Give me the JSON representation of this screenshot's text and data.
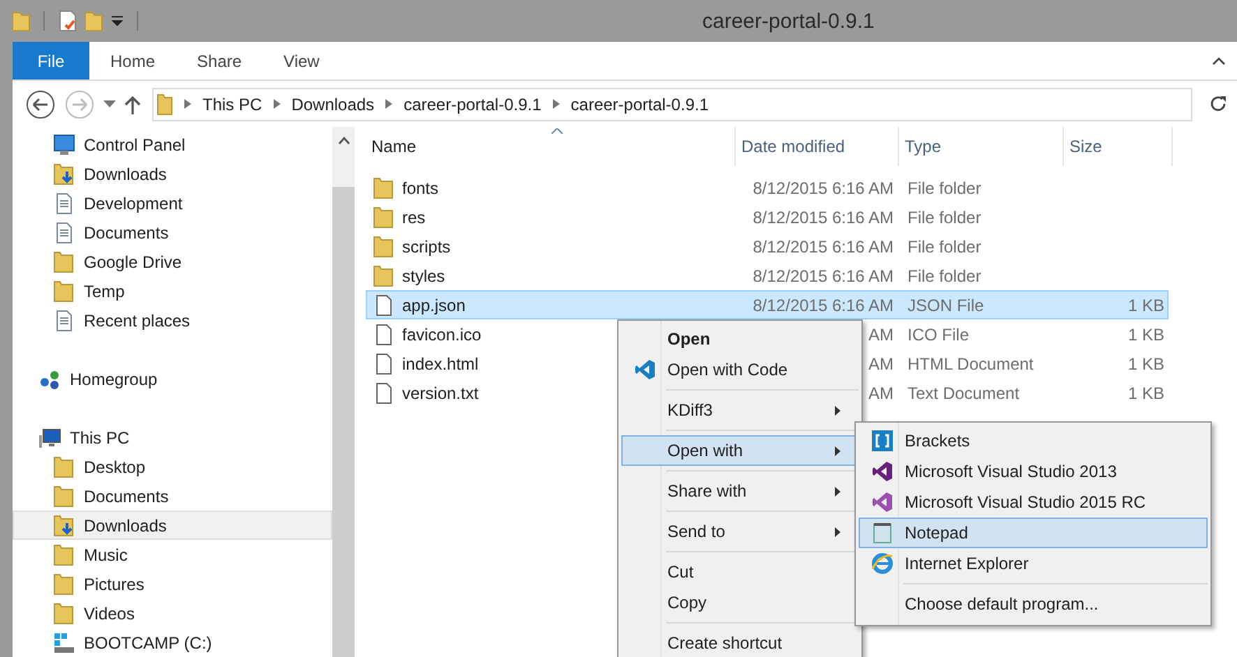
{
  "window": {
    "title": "career-portal-0.9.1"
  },
  "ribbon_tabs": [
    {
      "label": "File",
      "selected": true
    },
    {
      "label": "Home",
      "selected": false
    },
    {
      "label": "Share",
      "selected": false
    },
    {
      "label": "View",
      "selected": false
    }
  ],
  "breadcrumbs": [
    "This PC",
    "Downloads",
    "career-portal-0.9.1",
    "career-portal-0.9.1"
  ],
  "navigation": [
    {
      "children": [
        {
          "label": "Control Panel",
          "selected": false
        },
        {
          "label": "Downloads",
          "selected": false
        },
        {
          "label": "Development",
          "selected": false
        },
        {
          "label": "Documents",
          "selected": false
        },
        {
          "label": "Google Drive",
          "selected": false
        },
        {
          "label": "Temp",
          "selected": false
        },
        {
          "label": "Recent places",
          "selected": false
        }
      ]
    },
    {
      "label": "Homegroup",
      "selected": false
    },
    {
      "label": "This PC",
      "selected": false,
      "children": [
        {
          "label": "Desktop",
          "selected": false
        },
        {
          "label": "Documents",
          "selected": false
        },
        {
          "label": "Downloads",
          "selected": true
        },
        {
          "label": "Music",
          "selected": false
        },
        {
          "label": "Pictures",
          "selected": false
        },
        {
          "label": "Videos",
          "selected": false
        },
        {
          "label": "BOOTCAMP (C:)",
          "selected": false
        }
      ]
    }
  ],
  "table": {
    "columns": [
      "Name",
      "Date modified",
      "Type",
      "Size"
    ],
    "rows": [
      {
        "kind": "folder",
        "name": "fonts",
        "date": "8/12/2015 6:16 AM",
        "type": "File folder",
        "selected": false
      },
      {
        "kind": "folder",
        "name": "res",
        "date": "8/12/2015 6:16 AM",
        "type": "File folder",
        "selected": false
      },
      {
        "kind": "folder",
        "name": "scripts",
        "date": "8/12/2015 6:16 AM",
        "type": "File folder",
        "selected": false
      },
      {
        "kind": "folder",
        "name": "styles",
        "date": "8/12/2015 6:16 AM",
        "type": "File folder",
        "selected": false
      },
      {
        "kind": "file",
        "name": "app.json",
        "date": "8/12/2015 6:16 AM",
        "type": "JSON File",
        "size": "1 KB",
        "selected": true
      },
      {
        "kind": "file",
        "name": "favicon.ico",
        "date": "AM",
        "type": "ICO File",
        "size": "1 KB",
        "selected": false
      },
      {
        "kind": "file",
        "name": "index.html",
        "date": "AM",
        "type": "HTML Document",
        "size": "1 KB",
        "selected": false
      },
      {
        "kind": "file",
        "name": "version.txt",
        "date": "AM",
        "type": "Text Document",
        "size": "1 KB",
        "selected": false
      }
    ]
  },
  "context_menu": {
    "groups": [
      [
        {
          "label": "Open",
          "default": true,
          "submenu": false,
          "selected": false
        },
        {
          "label": "Open with Code",
          "default": false,
          "submenu": false,
          "selected": false
        }
      ],
      [
        {
          "label": "KDiff3",
          "default": false,
          "submenu": true,
          "selected": false
        }
      ],
      [
        {
          "label": "Open with",
          "default": false,
          "submenu": true,
          "selected": true
        }
      ],
      [
        {
          "label": "Share with",
          "default": false,
          "submenu": true,
          "selected": false
        }
      ],
      [
        {
          "label": "Send to",
          "default": false,
          "submenu": true,
          "selected": false
        }
      ],
      [
        {
          "label": "Cut",
          "default": false,
          "submenu": false,
          "selected": false
        },
        {
          "label": "Copy",
          "default": false,
          "submenu": false,
          "selected": false
        }
      ],
      [
        {
          "label": "Create shortcut",
          "default": false,
          "submenu": false,
          "selected": false
        }
      ]
    ]
  },
  "submenu": {
    "groups": [
      [
        {
          "label": "Brackets",
          "selected": false
        },
        {
          "label": "Microsoft Visual Studio 2013",
          "selected": false
        },
        {
          "label": "Microsoft Visual Studio 2015 RC",
          "selected": false
        },
        {
          "label": "Notepad",
          "selected": true
        },
        {
          "label": "Internet Explorer",
          "selected": false
        }
      ],
      [
        {
          "label": "Choose default program...",
          "selected": false
        }
      ]
    ]
  }
}
